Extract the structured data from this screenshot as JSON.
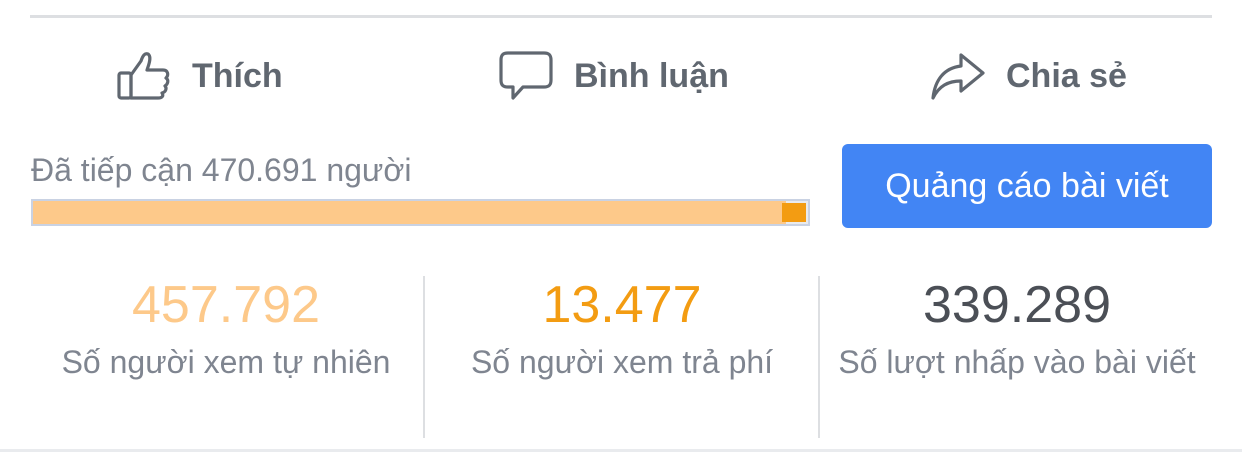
{
  "actions": {
    "like": {
      "label": "Thích",
      "icon": "thumbs-up-icon"
    },
    "comment": {
      "label": "Bình luận",
      "icon": "speech-bubble-icon"
    },
    "share": {
      "label": "Chia sẻ",
      "icon": "share-arrow-icon"
    }
  },
  "reach": {
    "label": "Đã tiếp cận 470.691 người",
    "organic_fraction": 0.9714,
    "paid_fraction": 0.0286
  },
  "boost_button": {
    "label": "Quảng cáo bài viết"
  },
  "stats": [
    {
      "value": "457.792",
      "caption": "Số người xem tự nhiên"
    },
    {
      "value": "13.477",
      "caption": "Số người xem trả phí"
    },
    {
      "value": "339.289",
      "caption": "Số lượt nhấp vào bài viết"
    }
  ],
  "colors": {
    "organic": "#fdc98a",
    "paid": "#f39c12",
    "button": "#4285f4",
    "text_muted": "#7f8590",
    "action_text": "#606770"
  }
}
